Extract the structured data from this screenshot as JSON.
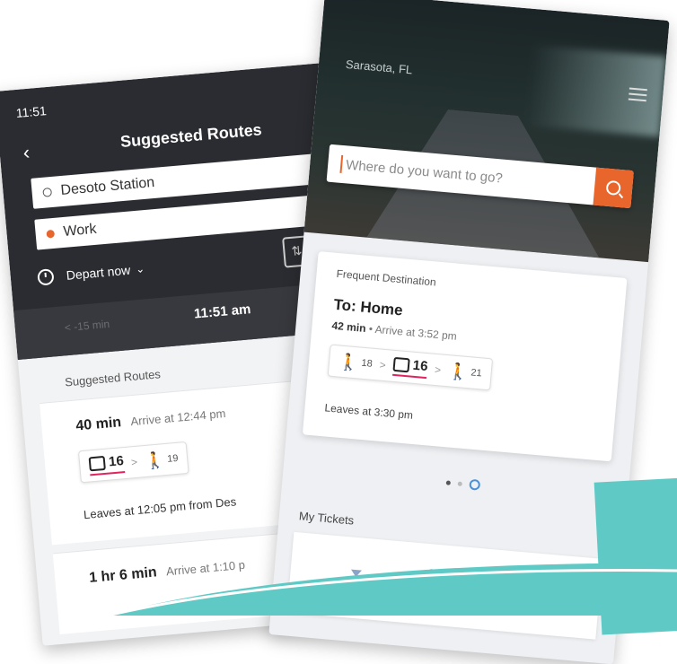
{
  "left_screen": {
    "status_time": "11:51",
    "back_label": "‹",
    "title": "Suggested Routes",
    "origin": "Desoto Station",
    "destination": "Work",
    "depart_label": "Depart now",
    "prev_time": "< -15 min",
    "current_time": "11:51 am",
    "section_title": "Suggested Routes",
    "routes": [
      {
        "duration": "40 min",
        "arrive": "Arrive at 12:44 pm",
        "bus": "16",
        "walk_mins": "19",
        "leaves": "Leaves at 12:05 pm from Des"
      },
      {
        "duration": "1 hr 6 min",
        "arrive": "Arrive at 1:10 p"
      }
    ]
  },
  "right_screen": {
    "location": "Sarasota, FL",
    "search_placeholder": "Where do you want to go?",
    "frequent_label": "Frequent Destination",
    "destination_title": "To: Home",
    "duration": "42 min",
    "arrive": "Arrive at 3:52 pm",
    "walk_before": "18",
    "bus": "16",
    "walk_after": "21",
    "leaves": "Leaves at 3:30 pm",
    "tickets_label": "My Tickets"
  },
  "colors": {
    "accent": "#e8652c",
    "dark_header": "#2b2c31",
    "bus_underline": "#e0245e",
    "teal": "#5fc9c5"
  }
}
